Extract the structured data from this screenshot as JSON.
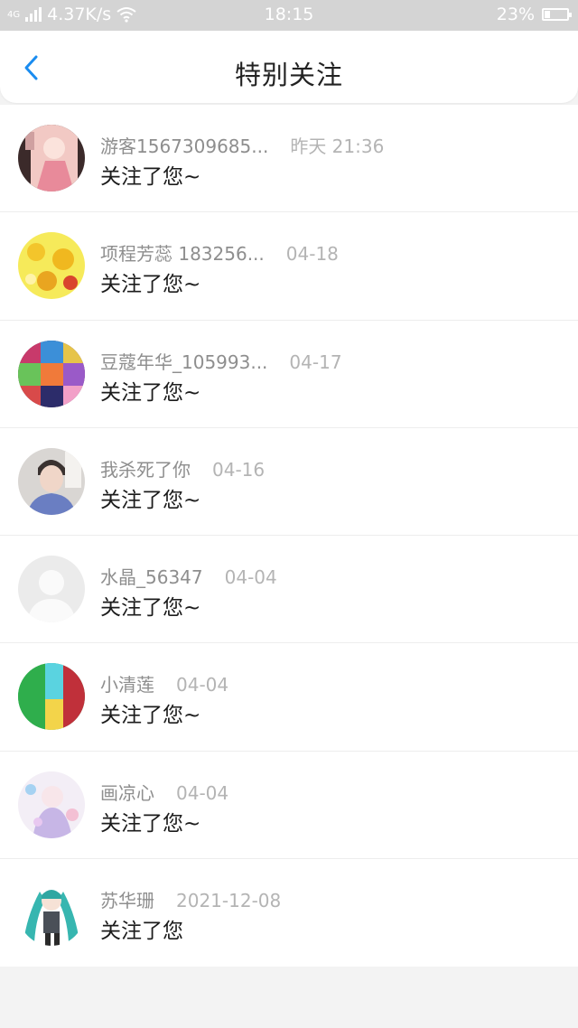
{
  "status_bar": {
    "network": "4G",
    "speed": "4.37K/s",
    "time": "18:15",
    "battery_percent": "23%",
    "battery_level": 0.23
  },
  "header": {
    "title": "特别关注",
    "back_icon": "chevron-left-icon"
  },
  "colors": {
    "accent": "#1a8cf0",
    "statusbar_bg": "#d4d4d4",
    "name_text": "#8e8e8e",
    "date_text": "#b4b4b4"
  },
  "items": [
    {
      "name": "游客1567309685...",
      "date": "昨天 21:36",
      "message": "关注了您~"
    },
    {
      "name": "项程芳蕊 183256...",
      "date": "04-18",
      "message": "关注了您~"
    },
    {
      "name": "豆蔻年华_105993...",
      "date": "04-17",
      "message": "关注了您~"
    },
    {
      "name": "我杀死了你",
      "date": "04-16",
      "message": "关注了您~"
    },
    {
      "name": "水晶_56347",
      "date": "04-04",
      "message": "关注了您~"
    },
    {
      "name": "小清莲",
      "date": "04-04",
      "message": "关注了您~"
    },
    {
      "name": "画凉心",
      "date": "04-04",
      "message": "关注了您~"
    },
    {
      "name": "苏华珊",
      "date": "2021-12-08",
      "message": "关注了您"
    }
  ]
}
